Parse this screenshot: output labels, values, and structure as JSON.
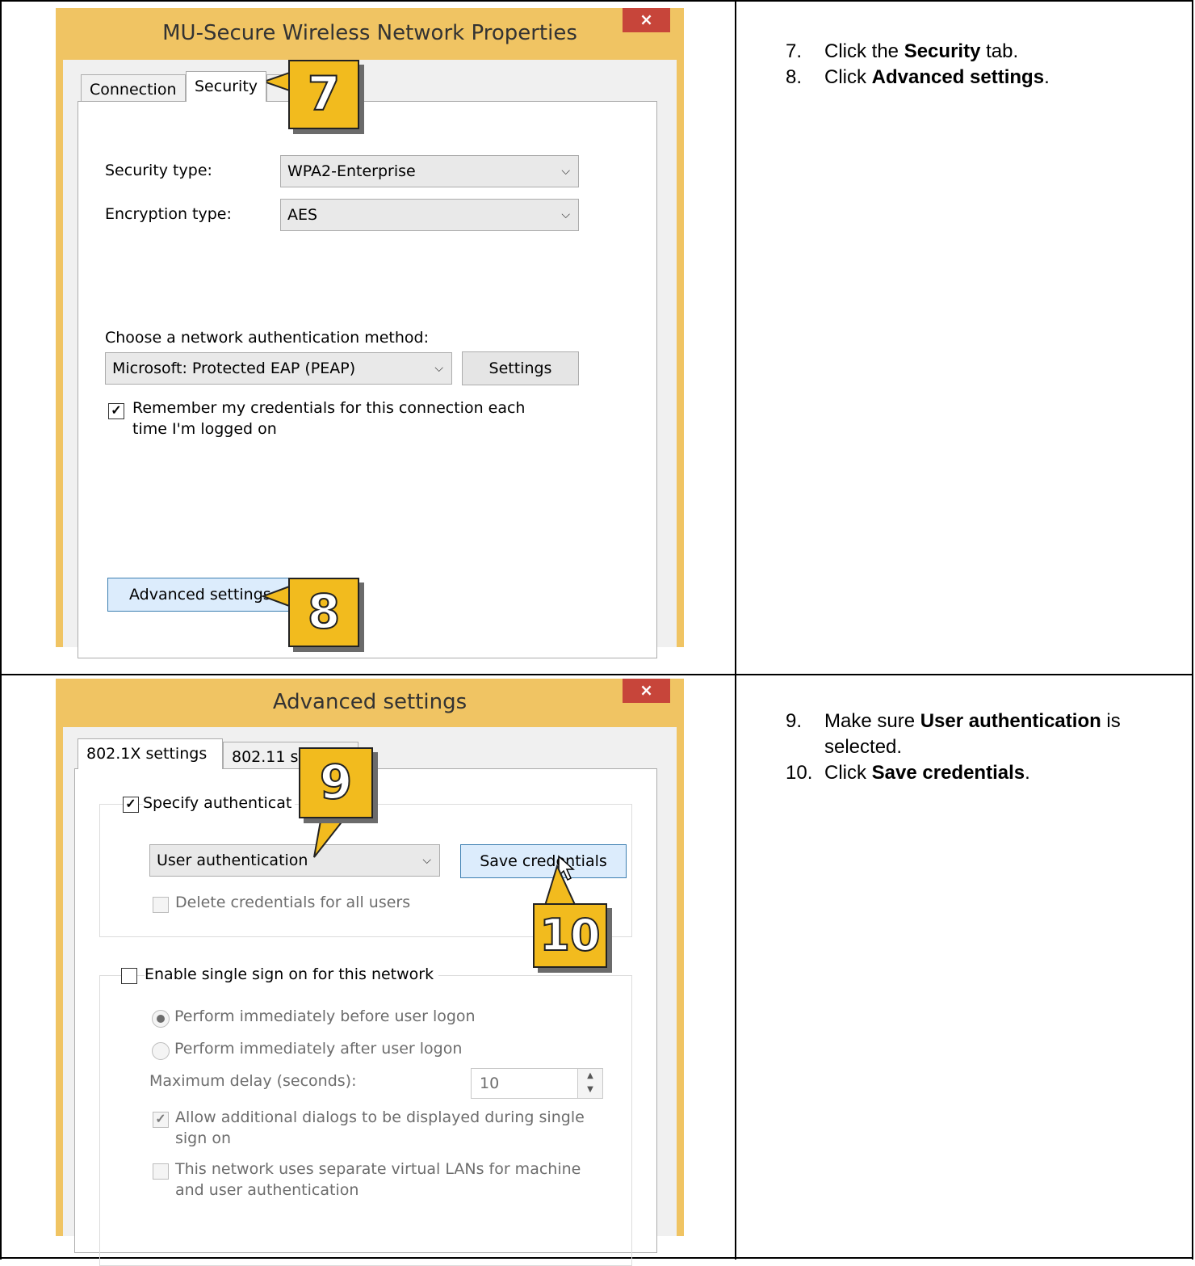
{
  "dialog1": {
    "title": "MU-Secure Wireless Network Properties",
    "close_label": "×",
    "tabs": [
      "Connection",
      "Security"
    ],
    "security_type_label": "Security type:",
    "security_type_value": "WPA2-Enterprise",
    "encryption_type_label": "Encryption type:",
    "encryption_type_value": "AES",
    "auth_method_label": "Choose a network authentication method:",
    "auth_method_value": "Microsoft: Protected EAP (PEAP)",
    "settings_button": "Settings",
    "remember_line1": "Remember my credentials for this connection each",
    "remember_line2": "time I'm logged on",
    "remember_checked": true,
    "advanced_button": "Advanced settings"
  },
  "dialog2": {
    "title": "Advanced settings",
    "close_label": "×",
    "tabs": [
      "802.1X settings",
      "802.11 s"
    ],
    "specify_auth_label": "Specify authenticat",
    "auth_mode_value": "User authentication",
    "save_credentials_button": "Save credentials",
    "delete_credentials_label": "Delete credentials for all users",
    "sso_label": "Enable single sign on for this network",
    "perform_before_label": "Perform immediately before user logon",
    "perform_after_label": "Perform immediately after user logon",
    "max_delay_label": "Maximum delay (seconds):",
    "max_delay_value": "10",
    "allow_dialogs_line1": "Allow additional dialogs to be displayed during single",
    "allow_dialogs_line2": "sign on",
    "vlan_line1": "This network uses separate virtual LANs for machine",
    "vlan_line2": "and user authentication"
  },
  "callouts": {
    "c7": "7",
    "c8": "8",
    "c9": "9",
    "c10": "10"
  },
  "instructions_top": [
    {
      "num": "7.",
      "pre": "Click the ",
      "bold": "Security",
      "post": " tab."
    },
    {
      "num": "8.",
      "pre": "Click ",
      "bold": "Advanced settings",
      "post": "."
    }
  ],
  "instructions_bottom": [
    {
      "num": "9.",
      "pre": "Make sure ",
      "bold": "User authentication",
      "post": " is selected."
    },
    {
      "num": "10.",
      "pre": "Click ",
      "bold": "Save credentials",
      "post": "."
    }
  ],
  "colors": {
    "frame": "#f0c463",
    "close": "#c7453a",
    "callout": "#f2bb1e"
  }
}
